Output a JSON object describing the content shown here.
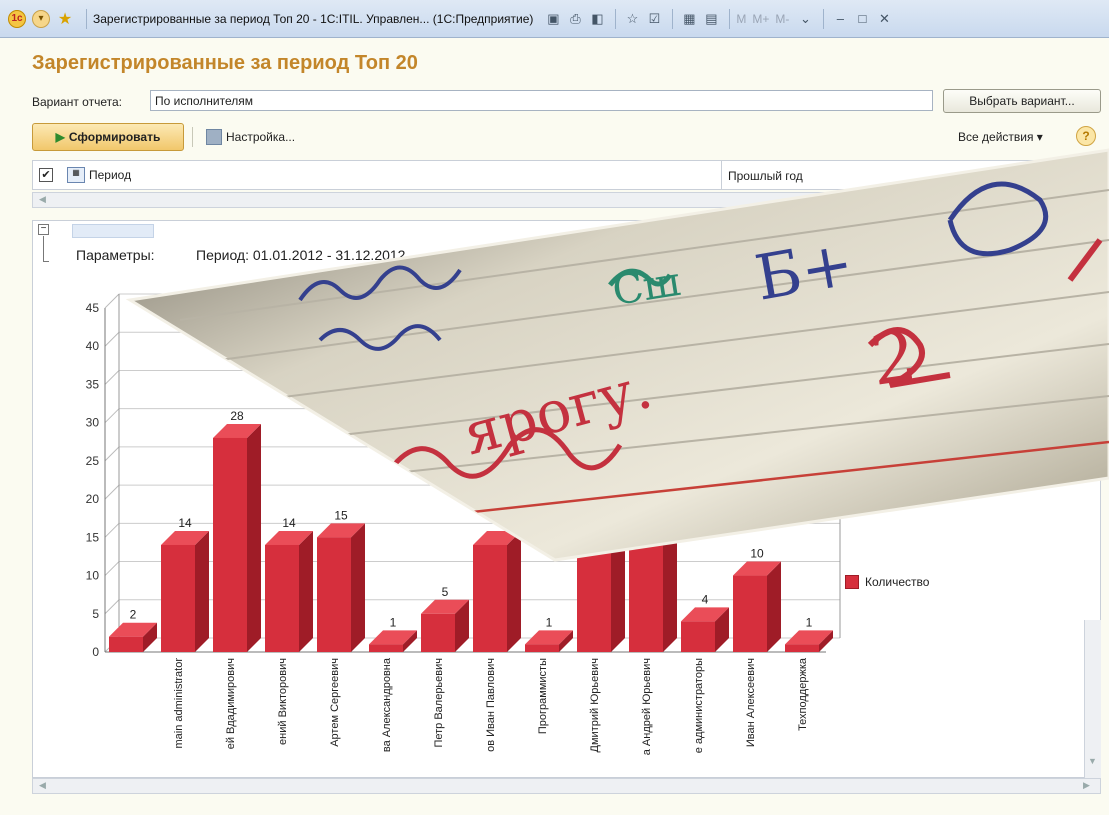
{
  "window": {
    "title": "Зарегистрированные за период Топ 20 - 1С:ITIL. Управлен... (1С:Предприятие)",
    "m_buttons": [
      "M",
      "M+",
      "M-"
    ]
  },
  "page": {
    "title": "Зарегистрированные за период Топ 20"
  },
  "variant": {
    "label": "Вариант отчета:",
    "value": "По исполнителям",
    "choose_button": "Выбрать вариант..."
  },
  "toolbar": {
    "form_button": "Сформировать",
    "settings_button": "Настройка...",
    "all_actions": "Все действия ▾",
    "help": "?"
  },
  "table": {
    "col_period": "Период",
    "col_prev_year": "Прошлый год"
  },
  "report": {
    "params_label": "Параметры:",
    "period_text": "Период: 01.01.2012 - 31.12.2012"
  },
  "chart_data": {
    "type": "bar",
    "ylim": [
      0,
      45
    ],
    "yticks": [
      0,
      5,
      10,
      15,
      20,
      25,
      30,
      35,
      40,
      45
    ],
    "categories": [
      "",
      "main administrator",
      "ей Вдадимирович",
      "ений Викторович",
      "Артем Сергеевич",
      "ва Александровна",
      "Петр Валерьевич",
      "ов Иван Павлович",
      "Программисты",
      "Дмитрий Юрьевич",
      "а Андрей Юрьевич",
      "е администраторы",
      "Иван Алексеевич",
      "Техподдержка"
    ],
    "series": [
      {
        "name": "Количество",
        "values": [
          2,
          14,
          28,
          14,
          15,
          1,
          5,
          14,
          1,
          14,
          14,
          4,
          10,
          1
        ]
      }
    ],
    "labels": [
      "2",
      "14",
      "28",
      "14",
      "15",
      "1",
      "5",
      "",
      "1",
      "",
      "",
      "4",
      "10",
      "1"
    ],
    "bar_color": "#d62f3d"
  },
  "photo_overlay": {
    "handwriting": [
      "Б+",
      "2",
      "Сш",
      "ярогу."
    ]
  }
}
